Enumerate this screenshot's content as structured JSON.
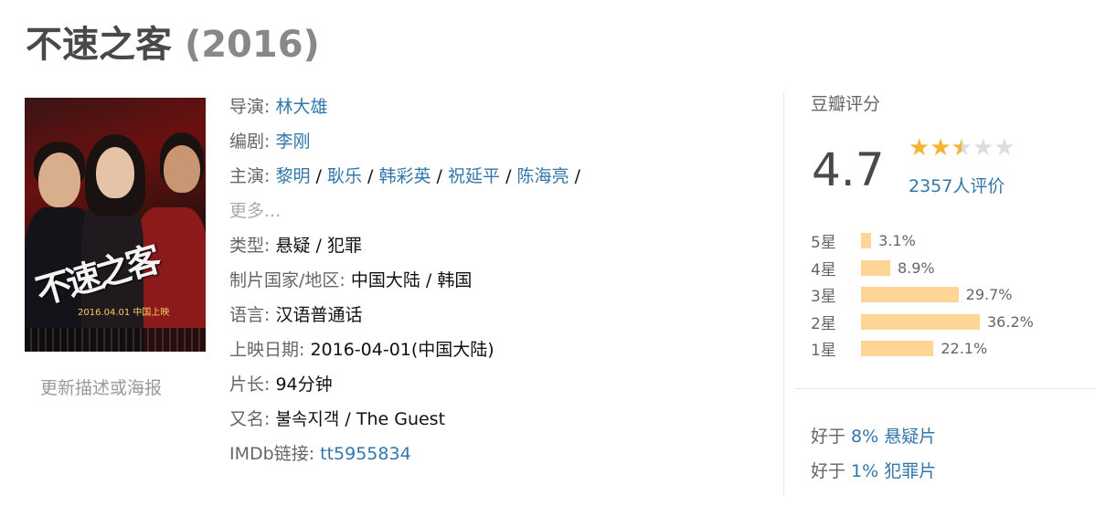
{
  "title": {
    "name": "不速之客",
    "year": "(2016)"
  },
  "poster": {
    "title_art": "不速之客",
    "date_text": "2016.04.01 中国上映"
  },
  "update_link": "更新描述或海报",
  "info": {
    "director": {
      "label": "导演:",
      "value": "林大雄"
    },
    "writer": {
      "label": "编剧:",
      "value": "李刚"
    },
    "cast": {
      "label": "主演:",
      "names": [
        "黎明",
        "耿乐",
        "韩彩英",
        "祝延平",
        "陈海亮"
      ],
      "sep": "/",
      "more": "更多..."
    },
    "genre": {
      "label": "类型:",
      "values": [
        "悬疑",
        "犯罪"
      ]
    },
    "country": {
      "label": "制片国家/地区:",
      "value": "中国大陆 / 韩国"
    },
    "language": {
      "label": "语言:",
      "value": "汉语普通话"
    },
    "release": {
      "label": "上映日期:",
      "value": "2016-04-01(中国大陆)"
    },
    "runtime": {
      "label": "片长:",
      "value": "94分钟"
    },
    "aka": {
      "label": "又名:",
      "value": "불속지객 / The Guest"
    },
    "imdb": {
      "label": "IMDb链接:",
      "value": "tt5955834"
    }
  },
  "rating": {
    "header": "豆瓣评分",
    "score": "4.7",
    "stars": 2.5,
    "votes": "2357人评价",
    "distribution": [
      {
        "label": "5星",
        "percent": 3.1,
        "text": "3.1%"
      },
      {
        "label": "4星",
        "percent": 8.9,
        "text": "8.9%"
      },
      {
        "label": "3星",
        "percent": 29.7,
        "text": "29.7%"
      },
      {
        "label": "2星",
        "percent": 36.2,
        "text": "36.2%"
      },
      {
        "label": "1星",
        "percent": 22.1,
        "text": "22.1%"
      }
    ],
    "better_than": [
      {
        "prefix": "好于",
        "percent": "8%",
        "genre": "悬疑片"
      },
      {
        "prefix": "好于",
        "percent": "1%",
        "genre": "犯罪片"
      }
    ]
  },
  "colors": {
    "link": "#3377aa",
    "star": "#f5b433",
    "bar": "#ffd596",
    "title": "#494949"
  }
}
